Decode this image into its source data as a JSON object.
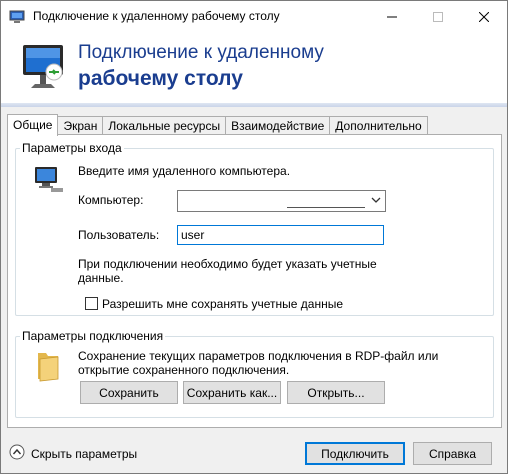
{
  "window": {
    "title": "Подключение к удаленному рабочему столу",
    "controls": {
      "minimize": "—",
      "maximize": "☐",
      "close": "✕"
    }
  },
  "banner": {
    "line1": "Подключение к удаленному",
    "line2": "рабочему столу",
    "icon": "remote-desktop-monitor-icon"
  },
  "tabs": [
    {
      "label": "Общие",
      "active": true
    },
    {
      "label": "Экран",
      "active": false
    },
    {
      "label": "Локальные ресурсы",
      "active": false
    },
    {
      "label": "Взаимодействие",
      "active": false
    },
    {
      "label": "Дополнительно",
      "active": false
    }
  ],
  "login": {
    "group_title": "Параметры входа",
    "intro": "Введите имя удаленного компьютера.",
    "computer_label": "Компьютер:",
    "computer_value": "",
    "user_label": "Пользователь:",
    "user_value": "user",
    "note_line1": "При подключении необходимо будет указать учетные",
    "note_line2": "данные.",
    "save_credentials_label": "Разрешить мне сохранять учетные данные",
    "save_credentials_checked": false
  },
  "connection": {
    "group_title": "Параметры подключения",
    "text_line1": "Сохранение текущих параметров подключения в RDP-файл или",
    "text_line2": "открытие сохраненного подключения.",
    "save_button": "Сохранить",
    "save_as_button": "Сохранить как...",
    "open_button": "Открыть..."
  },
  "footer": {
    "hide_params": "Скрыть параметры",
    "connect_button": "Подключить",
    "help_button": "Справка"
  }
}
